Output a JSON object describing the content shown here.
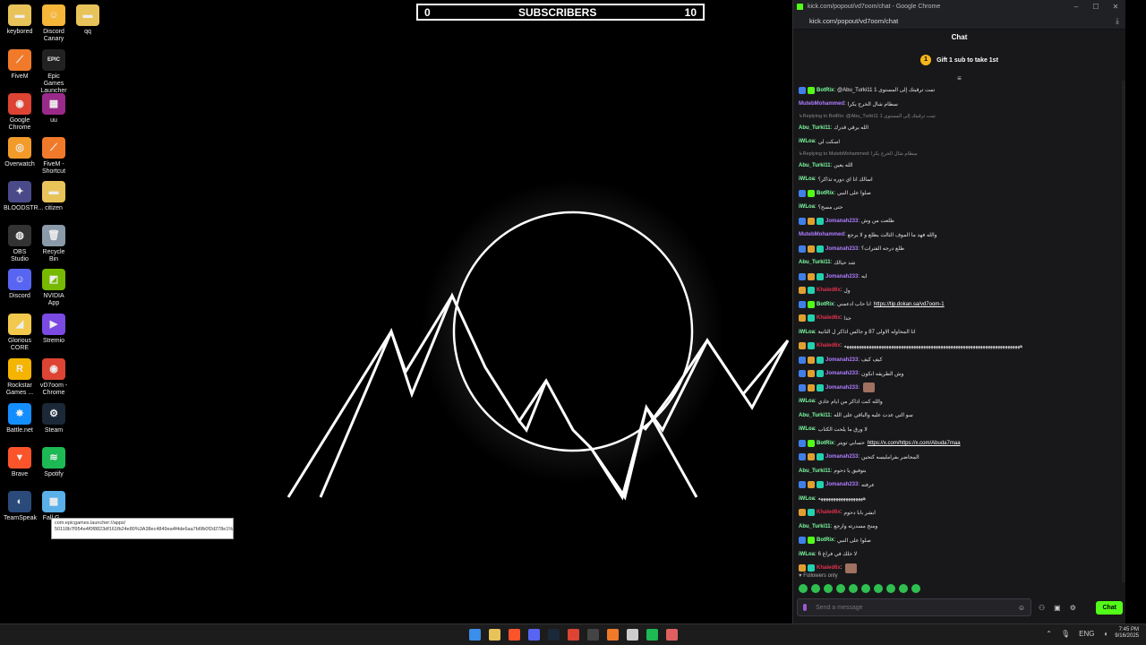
{
  "desktop": {
    "icons": [
      {
        "label": "keybored",
        "color": "#e8c35a",
        "glyph": "▬"
      },
      {
        "label": "Discord Canary",
        "color": "#f5b63a",
        "glyph": "☺"
      },
      {
        "label": "qq",
        "color": "#e8c35a",
        "glyph": "▬"
      },
      {
        "label": "FiveM",
        "color": "#f07a2a",
        "glyph": "⟋"
      },
      {
        "label": "Epic Games Launcher",
        "color": "#222222",
        "glyph": "EPIC"
      },
      {
        "label": "Google Chrome",
        "color": "#dd4433",
        "glyph": "◉"
      },
      {
        "label": "uu",
        "color": "#9a2a8a",
        "glyph": "▦"
      },
      {
        "label": "Overwatch",
        "color": "#f29b2a",
        "glyph": "◎"
      },
      {
        "label": "FiveM - Shortcut",
        "color": "#f07a2a",
        "glyph": "⟋"
      },
      {
        "label": "BLOODSTR...",
        "color": "#4a4a8a",
        "glyph": "✦"
      },
      {
        "label": "citizen",
        "color": "#e8c35a",
        "glyph": "▬"
      },
      {
        "label": "OBS Studio",
        "color": "#333333",
        "glyph": "◍"
      },
      {
        "label": "Recycle Bin",
        "color": "#8a9aa8",
        "glyph": "🗑"
      },
      {
        "label": "Discord",
        "color": "#5865f2",
        "glyph": "☺"
      },
      {
        "label": "NVIDIA App",
        "color": "#76b900",
        "glyph": "◩"
      },
      {
        "label": "Glorious CORE",
        "color": "#f2c94c",
        "glyph": "◢"
      },
      {
        "label": "Stremio",
        "color": "#7b4ae2",
        "glyph": "▶"
      },
      {
        "label": "Rockstar Games ...",
        "color": "#f4b400",
        "glyph": "R"
      },
      {
        "label": "vD7oom - Chrome",
        "color": "#dd4433",
        "glyph": "◉"
      },
      {
        "label": "Battle.net",
        "color": "#148eff",
        "glyph": "✸"
      },
      {
        "label": "Steam",
        "color": "#1b2838",
        "glyph": "⚙"
      },
      {
        "label": "Brave",
        "color": "#fb542b",
        "glyph": "▼"
      },
      {
        "label": "Spotify",
        "color": "#1db954",
        "glyph": "≋"
      },
      {
        "label": "TeamSpeak",
        "color": "#2a4a7a",
        "glyph": "◐"
      },
      {
        "label": "Fall G...",
        "color": "#5ab0e8",
        "glyph": "▦"
      }
    ],
    "tooltip": "com.epicgames.launcher://apps/ 50118b7f954e4f0f8823df161fb24e80%3A38ec4849ea4f4de6aa7b6fb0f2d278e1%3A0a2d9f6403444d19969e1b6e6713137b?..."
  },
  "overlay": {
    "left_value": "0",
    "title": "SUBSCRIBERS",
    "right_value": "10"
  },
  "browser": {
    "window_title": "kick.com/popout/vd7oom/chat - Google Chrome",
    "url": "kick.com/popout/vd7oom/chat"
  },
  "chat": {
    "header": "Chat",
    "gift_count": "1",
    "gift_text": "Gift 1 sub to take 1st",
    "followers_only": "Followers only",
    "input_placeholder": "Send a message",
    "send_label": "Chat",
    "colors": {
      "green": "#53fc18",
      "purple": "#b07cff",
      "red": "#e0314a",
      "light_green": "#7dffa0"
    }
  },
  "messages": [
    {
      "type": "msg",
      "badges": [
        "mod",
        "ver"
      ],
      "user": "BotRix",
      "color": "#7dffa0",
      "text": "@Abu_Turki11 تمت ترقيتك إلى المستوى 1"
    },
    {
      "type": "msg",
      "badges": [],
      "user": "MutebMohammed",
      "color": "#b07cff",
      "text": "سطام شال الخرج يكرا"
    },
    {
      "type": "reply",
      "text": "Replying to BotRix: @Abu_Turki11 تمت ترقيتك إلى المستوى 1"
    },
    {
      "type": "msg",
      "badges": [],
      "user": "Abu_Turki11",
      "color": "#7dffa0",
      "text": "الله يرقي قدرك"
    },
    {
      "type": "msg",
      "badges": [],
      "user": "iWLoa",
      "color": "#7dffa0",
      "text": "اسكت لي"
    },
    {
      "type": "reply",
      "text": "Replying to MutebMohammed: سطام شال الخرج يكرا"
    },
    {
      "type": "msg",
      "badges": [],
      "user": "Abu_Turki11",
      "color": "#7dffa0",
      "text": "الله يعين"
    },
    {
      "type": "msg",
      "badges": [],
      "user": "iWLoa",
      "color": "#7dffa0",
      "text": "اسالك انا اي دوره تذاكر؟"
    },
    {
      "type": "msg",
      "badges": [
        "mod",
        "ver"
      ],
      "user": "BotRix",
      "color": "#7dffa0",
      "text": "صلوا على النبي"
    },
    {
      "type": "msg",
      "badges": [],
      "user": "iWLoa",
      "color": "#7dffa0",
      "text": "حتى مسح؟"
    },
    {
      "type": "msg",
      "badges": [
        "mod",
        "crown",
        "sub"
      ],
      "user": "Jomanah233",
      "color": "#b07cff",
      "text": "طلعت من وش"
    },
    {
      "type": "msg",
      "badges": [],
      "user": "MutebMohammed",
      "color": "#b07cff",
      "text": "والله فهد ما الموف الثالث يطلع و لا يرجع"
    },
    {
      "type": "msg",
      "badges": [
        "mod",
        "crown",
        "sub"
      ],
      "user": "Jomanah233",
      "color": "#b07cff",
      "text": "طلع درجه الفترات؟"
    },
    {
      "type": "msg",
      "badges": [],
      "user": "Abu_Turki11",
      "color": "#7dffa0",
      "text": "شد حيالك"
    },
    {
      "type": "msg",
      "badges": [
        "mod",
        "crown",
        "sub"
      ],
      "user": "Jomanah233",
      "color": "#b07cff",
      "text": "ايه"
    },
    {
      "type": "msg",
      "badges": [
        "crown",
        "sub"
      ],
      "user": "Khaled6x",
      "color": "#e0314a",
      "text": "ول"
    },
    {
      "type": "msg",
      "badges": [
        "mod",
        "ver"
      ],
      "user": "BotRix",
      "color": "#7dffa0",
      "text": "انا حاب ادعمني",
      "link": "https://tip.dokan.sa/vd7oom-1"
    },
    {
      "type": "msg",
      "badges": [
        "crown",
        "sub"
      ],
      "user": "Khaled6x",
      "color": "#e0314a",
      "text": "جدا"
    },
    {
      "type": "msg",
      "badges": [],
      "user": "iWLoa",
      "color": "#7dffa0",
      "text": "انا المحاوله الاولى 87 و جالس اذاكر ل الثانية"
    },
    {
      "type": "msg",
      "badges": [
        "crown",
        "sub"
      ],
      "user": "Khaled6x",
      "color": "#e0314a",
      "text": "هههههههههههههههههههههههههههههههههههههههههههههههههههههههههههههههههههههههه"
    },
    {
      "type": "msg",
      "badges": [
        "mod",
        "crown",
        "sub"
      ],
      "user": "Jomanah233",
      "color": "#b07cff",
      "text": "كيف كيف"
    },
    {
      "type": "msg",
      "badges": [
        "mod",
        "crown",
        "sub"
      ],
      "user": "Jomanah233",
      "color": "#b07cff",
      "text": "وش الطريقه انكون"
    },
    {
      "type": "msg",
      "badges": [
        "mod",
        "crown",
        "sub"
      ],
      "user": "Jomanah233",
      "color": "#b07cff",
      "text": "",
      "emote": true
    },
    {
      "type": "msg",
      "badges": [],
      "user": "iWLoa",
      "color": "#7dffa0",
      "text": "والله كنت اذاكر من ايام عادي"
    },
    {
      "type": "msg",
      "badges": [],
      "user": "Abu_Turki11",
      "color": "#7dffa0",
      "text": "سو التي عدت عليه والباقي على الله"
    },
    {
      "type": "msg",
      "badges": [],
      "user": "iWLoa",
      "color": "#7dffa0",
      "text": "لا ورق ما يلحت الكتاب"
    },
    {
      "type": "msg",
      "badges": [
        "mod",
        "ver"
      ],
      "user": "BotRix",
      "color": "#7dffa0",
      "text": "حسابي تويتر",
      "link": "https://x.com/https://x.com/Abuda7maa"
    },
    {
      "type": "msg",
      "badges": [
        "mod",
        "crown",
        "sub"
      ],
      "user": "Jomanah233",
      "color": "#b07cff",
      "text": "المحاضر بفرامليسه كتحين"
    },
    {
      "type": "msg",
      "badges": [],
      "user": "Abu_Turki11",
      "color": "#7dffa0",
      "text": "بتوفيق يا دحوم"
    },
    {
      "type": "msg",
      "badges": [
        "mod",
        "crown",
        "sub"
      ],
      "user": "Jomanah233",
      "color": "#b07cff",
      "text": "عرفته"
    },
    {
      "type": "msg",
      "badges": [],
      "user": "iWLoa",
      "color": "#7dffa0",
      "text": "ههههههههههههههههههه"
    },
    {
      "type": "msg",
      "badges": [
        "crown",
        "sub"
      ],
      "user": "Khaled6x",
      "color": "#e0314a",
      "text": "ابشر بابا دحوم"
    },
    {
      "type": "msg",
      "badges": [],
      "user": "Abu_Turki11",
      "color": "#7dffa0",
      "text": "ومنح مسدرته وارجع"
    },
    {
      "type": "msg",
      "badges": [
        "mod",
        "ver"
      ],
      "user": "BotRix",
      "color": "#7dffa0",
      "text": "صلوا على النبي"
    },
    {
      "type": "msg",
      "badges": [],
      "user": "iWLoa",
      "color": "#7dffa0",
      "text": "لا خلك في فراغ 6"
    },
    {
      "type": "msg",
      "badges": [
        "crown",
        "sub"
      ],
      "user": "Khaled6x",
      "color": "#e0314a",
      "text": "",
      "emote": true
    }
  ],
  "taskbar": {
    "apps": [
      "#3b8eea",
      "#e8c35a",
      "#fb542b",
      "#5865f2",
      "#1b2838",
      "#dd4433",
      "#444444",
      "#f07a2a",
      "#cccccc",
      "#1db954",
      "#e06060"
    ],
    "lang": "ENG",
    "time": "7:45 PM",
    "date": "9/16/2025"
  }
}
